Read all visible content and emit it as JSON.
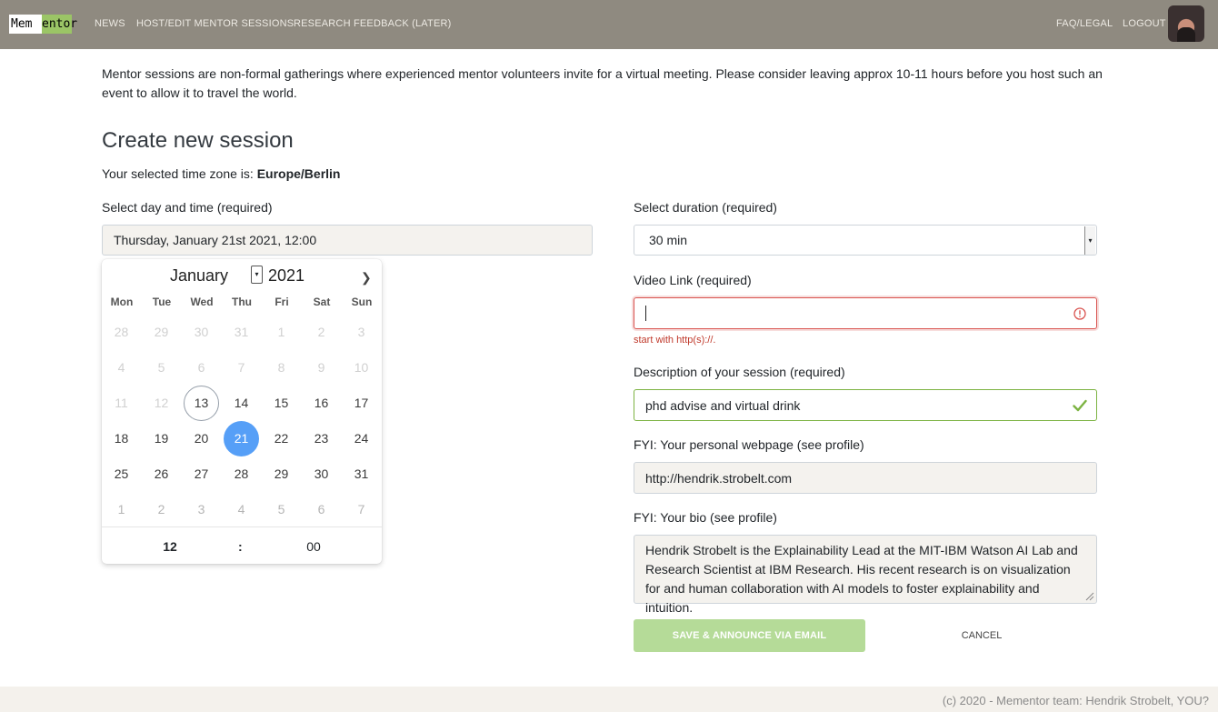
{
  "nav": {
    "logo_part1": "Mem",
    "logo_part2": "entor",
    "links": [
      "NEWS",
      "HOST/EDIT MENTOR SESSIONS",
      "RESEARCH FEEDBACK (LATER)"
    ],
    "right_links": [
      "FAQ/LEGAL",
      "LOGOUT"
    ],
    "avatar_icon": "user-avatar"
  },
  "intro": "Mentor sessions are non-formal gatherings where experienced mentor volunteers invite for a virtual meeting. Please consider leaving approx 10-11 hours before you host such an event to allow it to travel the world.",
  "form": {
    "title": "Create new session",
    "tz_prefix": "Your selected time zone is: ",
    "tz_value": "Europe/Berlin",
    "datetime_label": "Select day and time (required)",
    "datetime_value": "Thursday, January 21st 2021, 12:00",
    "duration_label": "Select duration (required)",
    "duration_value": "30 min",
    "video_label": "Video Link (required)",
    "video_value": "",
    "video_error": "start with http(s)://.",
    "description_label": "Description of your session (required)",
    "description_value": "phd advise and virtual drink",
    "webpage_label": "FYI: Your personal webpage (see profile)",
    "webpage_value": "http://hendrik.strobelt.com",
    "bio_label": "FYI: Your bio (see profile)",
    "bio_value": "Hendrik Strobelt is the Explainability Lead at the MIT-IBM Watson AI Lab and Research Scientist at IBM Research. His recent research is on visualization for and human collaboration with AI models to foster explainability and intuition.",
    "save_label": "SAVE & ANNOUNCE VIA EMAIL",
    "cancel_label": "CANCEL",
    "error_color": "#d9534f",
    "success_color": "#7cb342",
    "accent_color": "#569ff7"
  },
  "calendar": {
    "month": "January",
    "year": "2021",
    "weekdays": [
      "Mon",
      "Tue",
      "Wed",
      "Thu",
      "Fri",
      "Sat",
      "Sun"
    ],
    "weeks": [
      [
        "28",
        "29",
        "30",
        "31",
        "1",
        "2",
        "3"
      ],
      [
        "4",
        "5",
        "6",
        "7",
        "8",
        "9",
        "10"
      ],
      [
        "11",
        "12",
        "13",
        "14",
        "15",
        "16",
        "17"
      ],
      [
        "18",
        "19",
        "20",
        "21",
        "22",
        "23",
        "24"
      ],
      [
        "25",
        "26",
        "27",
        "28",
        "29",
        "30",
        "31"
      ],
      [
        "1",
        "2",
        "3",
        "4",
        "5",
        "6",
        "7"
      ]
    ],
    "today": "13",
    "selected": "21",
    "hour": "12",
    "separator": ":",
    "minute": "00"
  },
  "footer": "(c) 2020 - Mementor team: Hendrik Strobelt, YOU?"
}
